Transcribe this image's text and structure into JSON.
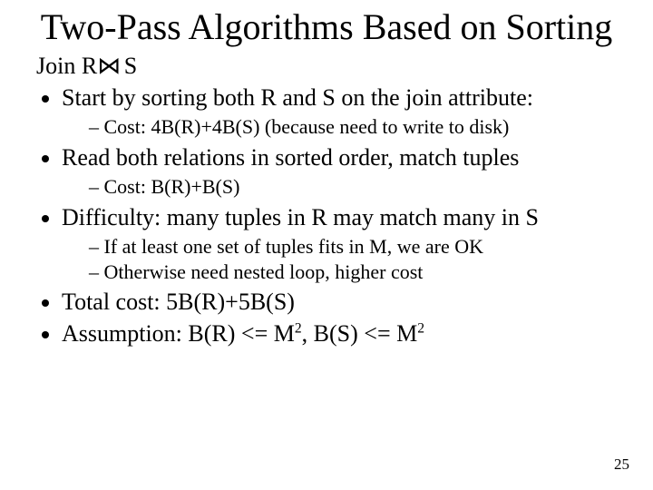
{
  "title": "Two-Pass Algorithms Based on Sorting",
  "lead_prefix": "Join R",
  "join_symbol": "⋈",
  "lead_suffix": "  S",
  "bullets": {
    "b1": "Start by sorting both R and S on the join attribute:",
    "b1_sub1": "Cost: 4B(R)+4B(S)  (because need to write to disk)",
    "b2": "Read both relations in sorted order, match tuples",
    "b2_sub1": "Cost: B(R)+B(S)",
    "b3": "Difficulty: many tuples in R may match many in S",
    "b3_sub1": "If at least one set of tuples fits in M, we are OK",
    "b3_sub2": "Otherwise need nested loop, higher cost",
    "b4": "Total cost: 5B(R)+5B(S)",
    "b5_prefix": "Assumption: B(R) <= M",
    "b5_mid": ", B(S) <= M",
    "sup": "2"
  },
  "page_number": "25"
}
